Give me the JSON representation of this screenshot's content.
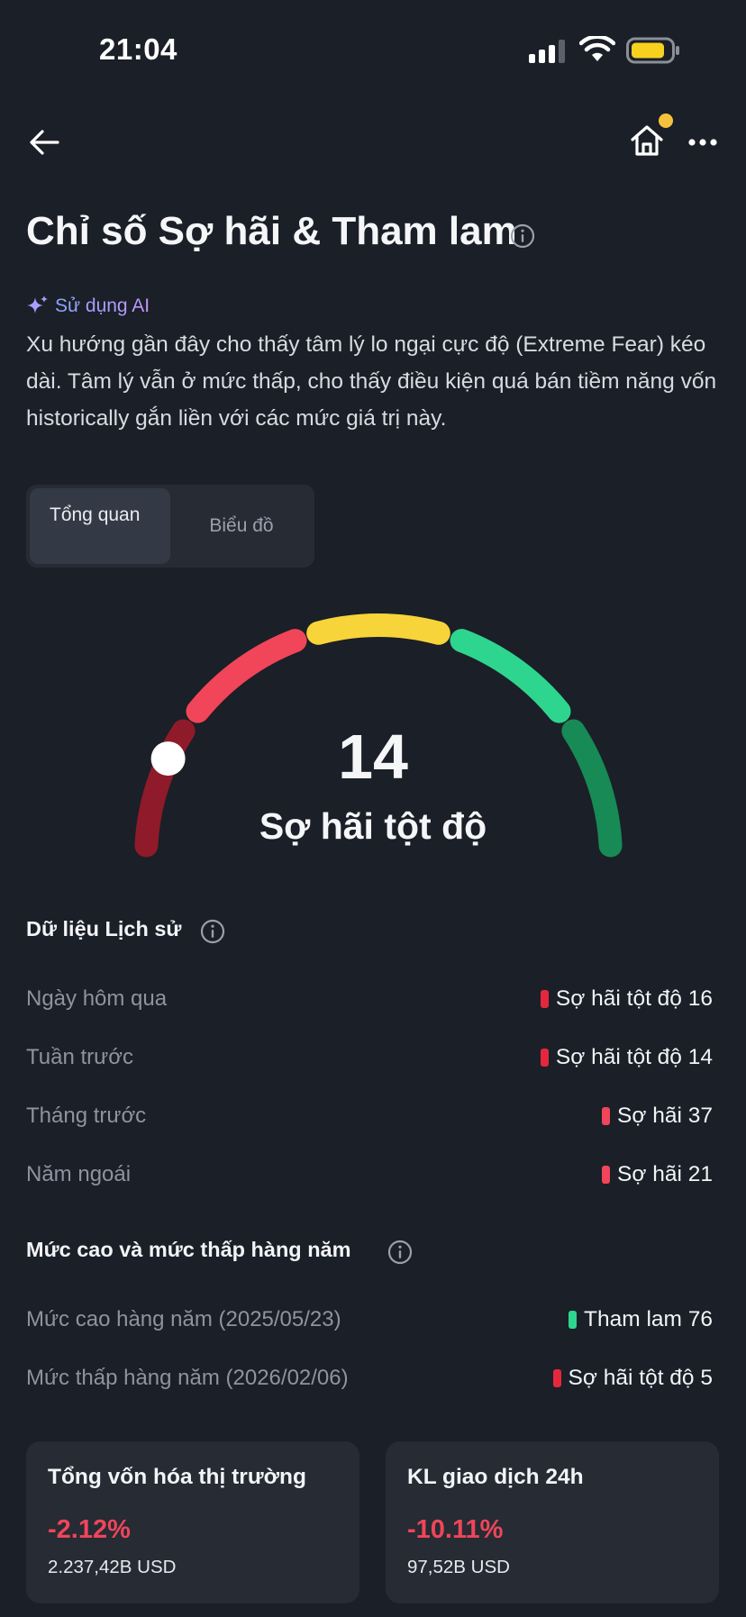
{
  "status_bar": {
    "time": "21:04"
  },
  "header": {
    "title": "Chỉ số Sợ hãi & Tham lam"
  },
  "ai": {
    "label": "Sử dụng AI",
    "summary": "Xu hướng gần đây cho thấy tâm lý lo ngại cực độ (Extreme Fear) kéo dài. Tâm lý vẫn ở mức thấp, cho thấy điều kiện quá bán tiềm năng vốn historically gắn liền với các mức giá trị này."
  },
  "tabs": [
    {
      "label": "Tổng quan",
      "active": true
    },
    {
      "label": "Biểu đồ",
      "active": false
    }
  ],
  "gauge": {
    "value": "14",
    "label": "Sợ hãi tột độ",
    "level": 0.14,
    "segment_colors": [
      "#8e1a2a",
      "#f1455a",
      "#f7d43a",
      "#2ed58e",
      "#178a55"
    ]
  },
  "history": {
    "title": "Dữ liệu Lịch sử",
    "rows": [
      {
        "label": "Ngày hôm qua",
        "value": "Sợ hãi tột độ 16",
        "color": "#e5273e"
      },
      {
        "label": "Tuần trước",
        "value": "Sợ hãi tột độ 14",
        "color": "#e5273e"
      },
      {
        "label": "Tháng trước",
        "value": "Sợ hãi 37",
        "color": "#f1455a"
      },
      {
        "label": "Năm ngoái",
        "value": "Sợ hãi 21",
        "color": "#f1455a"
      }
    ]
  },
  "yearly": {
    "title": "Mức cao và mức thấp hàng năm",
    "rows": [
      {
        "label": "Mức cao hàng năm (2025/05/23)",
        "value": "Tham lam 76",
        "color": "#2ed58e"
      },
      {
        "label": "Mức thấp hàng năm (2026/02/06)",
        "value": "Sợ hãi tột độ 5",
        "color": "#e5273e"
      }
    ]
  },
  "cards": [
    {
      "title": "Tổng vốn hóa thị trường",
      "change": "-2.12%",
      "amount": "2.237,42B USD"
    },
    {
      "title": "KL giao dịch 24h",
      "change": "-10.11%",
      "amount": "97,52B USD"
    }
  ],
  "colors": {
    "background": "#1b1f27",
    "surface": "#262b34",
    "negative": "#f0455a",
    "ai_gradient_start": "#8aa8ff",
    "ai_gradient_end": "#c497ff"
  }
}
